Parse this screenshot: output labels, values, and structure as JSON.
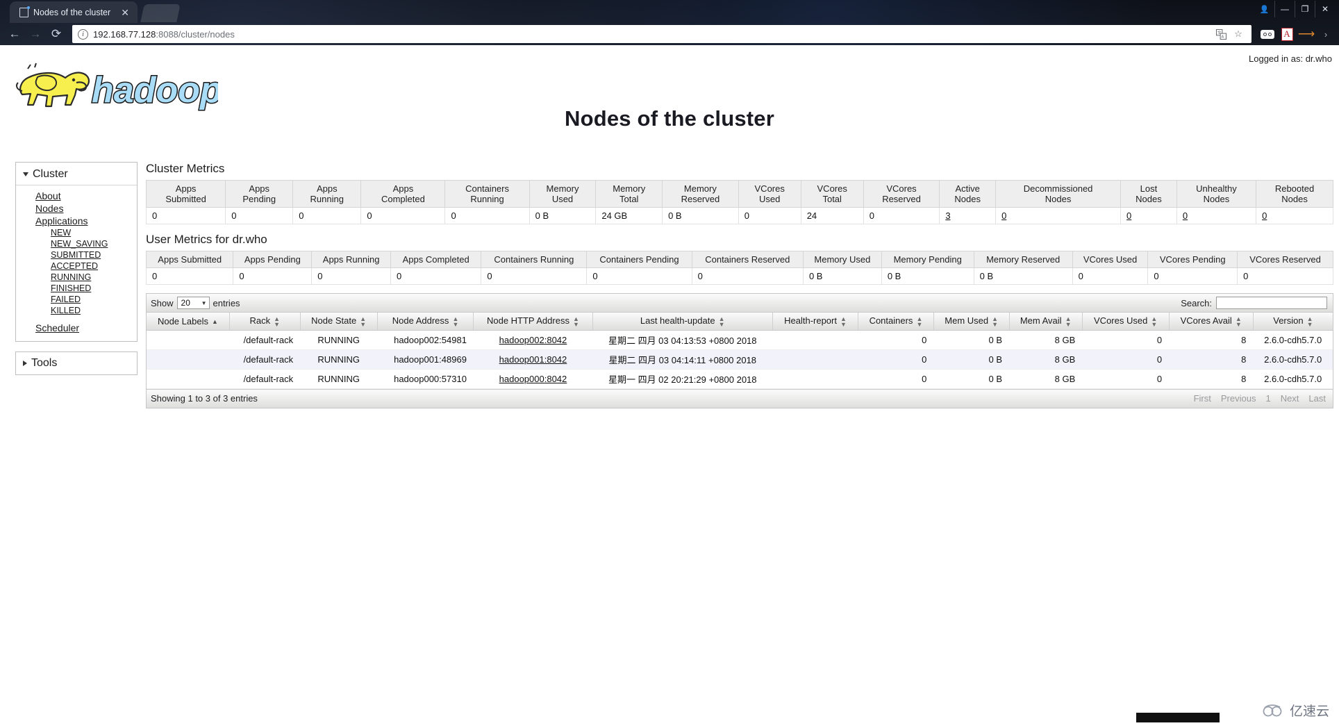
{
  "browser": {
    "tab_title": "Nodes of the cluster",
    "tab_close": "✕",
    "back_icon": "←",
    "forward_icon": "→",
    "reload_icon": "⟳",
    "url_host": "192.168.77.128",
    "url_path": ":8088/cluster/nodes",
    "translate_icon": "translate-icon",
    "bookmark_icon": "☆",
    "minimize": "—",
    "maximize": "❐",
    "close": "✕",
    "profile": "person-icon",
    "ext_chevron": "›"
  },
  "page": {
    "logged_in": "Logged in as: dr.who",
    "title": "Nodes of the cluster",
    "logo_alt": "hadoop"
  },
  "sidebar": {
    "cluster_label": "Cluster",
    "tools_label": "Tools",
    "items": [
      {
        "label": "About",
        "level": 1
      },
      {
        "label": "Nodes",
        "level": 1
      },
      {
        "label": "Applications",
        "level": 1
      },
      {
        "label": "NEW",
        "level": 2
      },
      {
        "label": "NEW_SAVING",
        "level": 2
      },
      {
        "label": "SUBMITTED",
        "level": 2
      },
      {
        "label": "ACCEPTED",
        "level": 2
      },
      {
        "label": "RUNNING",
        "level": 2
      },
      {
        "label": "FINISHED",
        "level": 2
      },
      {
        "label": "FAILED",
        "level": 2
      },
      {
        "label": "KILLED",
        "level": 2
      },
      {
        "label": "Scheduler",
        "level": 1
      }
    ]
  },
  "cluster_metrics": {
    "title": "Cluster Metrics",
    "headers": [
      "Apps\nSubmitted",
      "Apps\nPending",
      "Apps\nRunning",
      "Apps\nCompleted",
      "Containers\nRunning",
      "Memory\nUsed",
      "Memory\nTotal",
      "Memory\nReserved",
      "VCores\nUsed",
      "VCores\nTotal",
      "VCores\nReserved",
      "Active\nNodes",
      "Decommissioned\nNodes",
      "Lost\nNodes",
      "Unhealthy\nNodes",
      "Rebooted\nNodes"
    ],
    "values": [
      "0",
      "0",
      "0",
      "0",
      "0",
      "0 B",
      "24 GB",
      "0 B",
      "0",
      "24",
      "0",
      "3",
      "0",
      "0",
      "0",
      "0"
    ],
    "linked": [
      false,
      false,
      false,
      false,
      false,
      false,
      false,
      false,
      false,
      false,
      false,
      true,
      true,
      true,
      true,
      true
    ]
  },
  "user_metrics": {
    "title": "User Metrics for dr.who",
    "headers": [
      "Apps Submitted",
      "Apps Pending",
      "Apps Running",
      "Apps Completed",
      "Containers Running",
      "Containers Pending",
      "Containers Reserved",
      "Memory Used",
      "Memory Pending",
      "Memory Reserved",
      "VCores Used",
      "VCores Pending",
      "VCores Reserved"
    ],
    "values": [
      "0",
      "0",
      "0",
      "0",
      "0",
      "0",
      "0",
      "0 B",
      "0 B",
      "0 B",
      "0",
      "0",
      "0"
    ]
  },
  "datatable": {
    "show_label": "Show",
    "entries_label": "entries",
    "page_length": "20",
    "select_arrow": "▼",
    "search_label": "Search:",
    "search_value": "",
    "search_placeholder": "",
    "info": "Showing 1 to 3 of 3 entries",
    "paging": {
      "first": "First",
      "previous": "Previous",
      "page": "1",
      "next": "Next",
      "last": "Last"
    },
    "headers": [
      {
        "label": "Node Labels",
        "sort": "asc"
      },
      {
        "label": "Rack",
        "sort": "both"
      },
      {
        "label": "Node State",
        "sort": "both"
      },
      {
        "label": "Node Address",
        "sort": "both"
      },
      {
        "label": "Node HTTP Address",
        "sort": "both"
      },
      {
        "label": "Last health-update",
        "sort": "both"
      },
      {
        "label": "Health-report",
        "sort": "both"
      },
      {
        "label": "Containers",
        "sort": "both"
      },
      {
        "label": "Mem Used",
        "sort": "both"
      },
      {
        "label": "Mem Avail",
        "sort": "both"
      },
      {
        "label": "VCores Used",
        "sort": "both"
      },
      {
        "label": "VCores Avail",
        "sort": "both"
      },
      {
        "label": "Version",
        "sort": "both"
      }
    ],
    "rows": [
      {
        "node_labels": "",
        "rack": "/default-rack",
        "node_state": "RUNNING",
        "node_address": "hadoop002:54981",
        "node_http_address": "hadoop002:8042",
        "last_health_update": "星期二 四月 03 04:13:53 +0800 2018",
        "health_report": "",
        "containers": "0",
        "mem_used": "0 B",
        "mem_avail": "8 GB",
        "vcores_used": "0",
        "vcores_avail": "8",
        "version": "2.6.0-cdh5.7.0"
      },
      {
        "node_labels": "",
        "rack": "/default-rack",
        "node_state": "RUNNING",
        "node_address": "hadoop001:48969",
        "node_http_address": "hadoop001:8042",
        "last_health_update": "星期二 四月 03 04:14:11 +0800 2018",
        "health_report": "",
        "containers": "0",
        "mem_used": "0 B",
        "mem_avail": "8 GB",
        "vcores_used": "0",
        "vcores_avail": "8",
        "version": "2.6.0-cdh5.7.0"
      },
      {
        "node_labels": "",
        "rack": "/default-rack",
        "node_state": "RUNNING",
        "node_address": "hadoop000:57310",
        "node_http_address": "hadoop000:8042",
        "last_health_update": "星期一 四月 02 20:21:29 +0800 2018",
        "health_report": "",
        "containers": "0",
        "mem_used": "0 B",
        "mem_avail": "8 GB",
        "vcores_used": "0",
        "vcores_avail": "8",
        "version": "2.6.0-cdh5.7.0"
      }
    ]
  },
  "watermark": {
    "text": "亿速云"
  },
  "colors": {
    "logo_yellow": "#f6ef4e",
    "logo_blue": "#a9ddf7",
    "row_alt": "#f2f2fa",
    "header_grey": "#eeeeee"
  }
}
